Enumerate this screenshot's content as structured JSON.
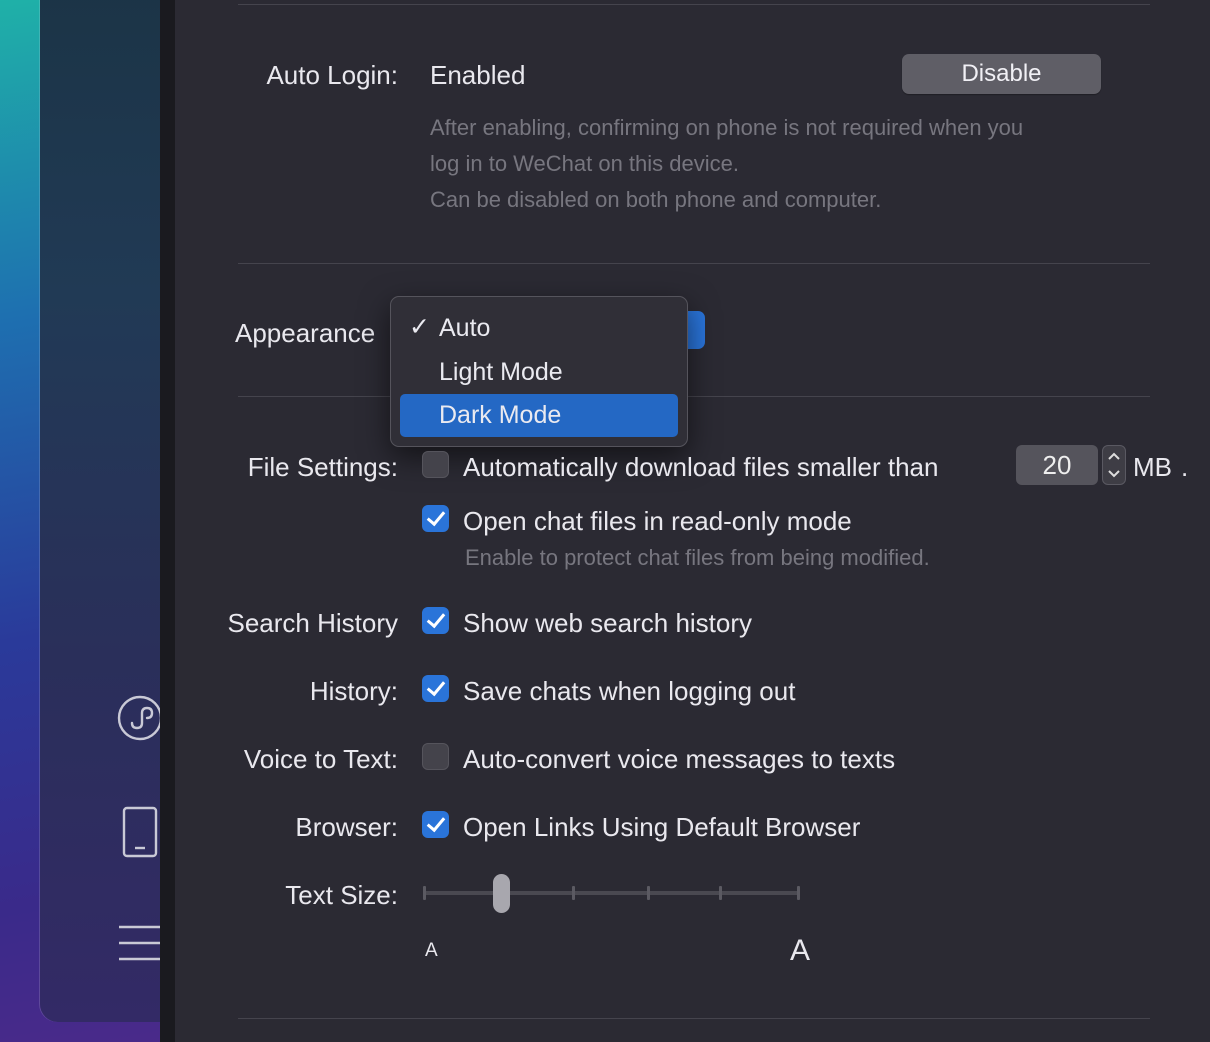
{
  "sidebar": {
    "icons": [
      "miniprogram-icon",
      "phone-icon",
      "menu-icon"
    ]
  },
  "auto_login": {
    "label": "Auto Login:",
    "status": "Enabled",
    "button": "Disable",
    "hint_line1": "After enabling, confirming on phone is not required when you",
    "hint_line2": "log in to WeChat on this device.",
    "hint_line3": "Can be disabled on both phone and computer."
  },
  "appearance": {
    "label": "Appearance",
    "menu": {
      "check": "✓",
      "items": [
        "Auto",
        "Light Mode",
        "Dark Mode"
      ],
      "checked": "Auto",
      "highlighted": "Dark Mode"
    }
  },
  "file_settings": {
    "label": "File Settings:",
    "auto_download": {
      "text": "Automatically download files smaller than",
      "checked": false
    },
    "size_value": "20",
    "unit": "MB",
    "period": ".",
    "read_only": {
      "text": "Open chat files in read-only mode",
      "checked": true
    },
    "read_only_hint": "Enable to protect chat files from being modified."
  },
  "search_history": {
    "label": "Search History",
    "text": "Show web search history",
    "checked": true
  },
  "history": {
    "label": "History:",
    "text": "Save chats when logging out",
    "checked": true
  },
  "voice_to_text": {
    "label": "Voice to Text:",
    "text": "Auto-convert voice messages to texts",
    "checked": false
  },
  "browser": {
    "label": "Browser:",
    "text": "Open Links Using Default Browser",
    "checked": true
  },
  "text_size": {
    "label": "Text Size:",
    "small_a": "A",
    "large_a": "A",
    "level": 2,
    "levels": 6
  },
  "colors": {
    "accent": "#2a74d9",
    "background": "#2b2a33",
    "hint": "#77767f"
  }
}
